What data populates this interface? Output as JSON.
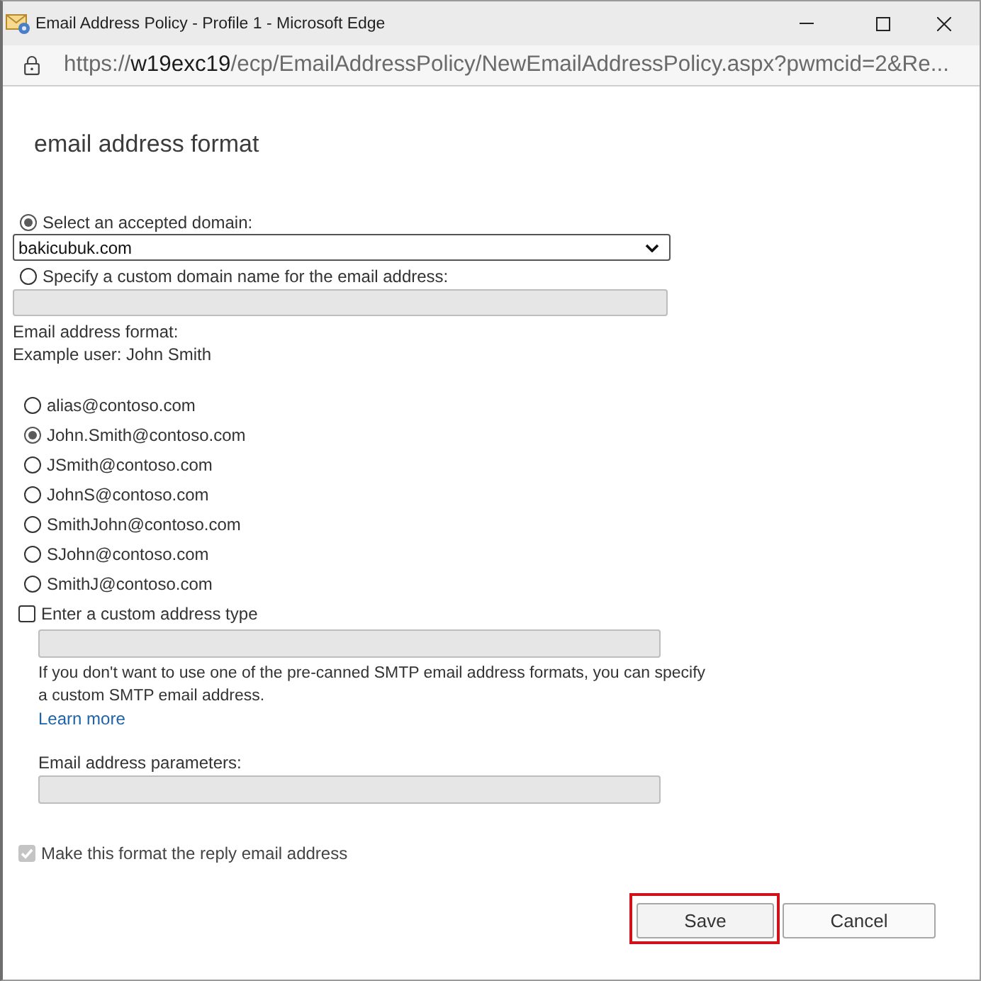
{
  "window": {
    "title": "Email Address Policy - Profile 1 - Microsoft Edge"
  },
  "address_bar": {
    "scheme": "https://",
    "host": "w19exc19",
    "path": "/ecp/EmailAddressPolicy/NewEmailAddressPolicy.aspx?pwmcid=2&Re..."
  },
  "form": {
    "heading": "email address format",
    "domain_options": [
      {
        "kind": "dropdown",
        "label": "Select an accepted domain:",
        "selected": true,
        "value": "bakicubuk.com"
      },
      {
        "kind": "text",
        "label": "Specify a custom domain name for the email address:",
        "selected": false
      }
    ],
    "format_label": "Email address format:",
    "example_user": "Example user: John Smith",
    "formats": [
      {
        "label": "alias@contoso.com",
        "selected": false
      },
      {
        "label": "John.Smith@contoso.com",
        "selected": true
      },
      {
        "label": "JSmith@contoso.com",
        "selected": false
      },
      {
        "label": "JohnS@contoso.com",
        "selected": false
      },
      {
        "label": "SmithJohn@contoso.com",
        "selected": false
      },
      {
        "label": "SJohn@contoso.com",
        "selected": false
      },
      {
        "label": "SmithJ@contoso.com",
        "selected": false
      }
    ],
    "custom_type": {
      "label": "Enter a custom address type",
      "checked": false,
      "help": "If you don't want to use one of the pre-canned SMTP email address formats, you can specify a custom SMTP email address.",
      "link": "Learn more",
      "parameters_label": "Email address parameters:"
    },
    "reply_option": {
      "label": "Make this format the reply email address",
      "checked": true,
      "disabled": true
    },
    "buttons": [
      {
        "label": "Save",
        "highlighted": true
      },
      {
        "label": "Cancel",
        "highlighted": false
      }
    ]
  }
}
